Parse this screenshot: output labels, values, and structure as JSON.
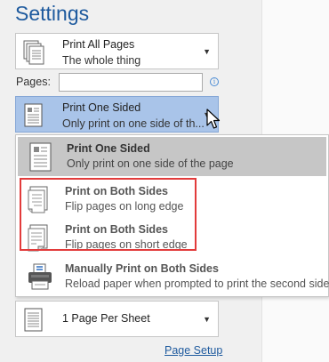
{
  "title": "Settings",
  "print_range": {
    "label": "Print All Pages",
    "desc": "The whole thing"
  },
  "pages": {
    "label": "Pages:",
    "value": "",
    "info_glyph": "i"
  },
  "sides": {
    "label": "Print One Sided",
    "desc": "Only print on one side of th..."
  },
  "menu": {
    "items": [
      {
        "title": "Print One Sided",
        "desc": "Only print on one side of the page",
        "icon": "one-sided-page-icon"
      },
      {
        "title": "Print on Both Sides",
        "desc": "Flip pages on long edge",
        "icon": "flip-long-edge-icon"
      },
      {
        "title": "Print on Both Sides",
        "desc": "Flip pages on short edge",
        "icon": "flip-short-edge-icon"
      },
      {
        "title": "Manually Print on Both Sides",
        "desc": "Reload paper when prompted to print the second side",
        "icon": "printer-icon"
      }
    ]
  },
  "pages_per_sheet": {
    "label": "1 Page Per Sheet"
  },
  "page_setup_link": "Page Setup",
  "colors": {
    "accent": "#1e5a9e",
    "selected_bg": "#a9c4e9",
    "menu_active_bg": "#c6c6c6",
    "highlight_border": "#e23b3b"
  }
}
